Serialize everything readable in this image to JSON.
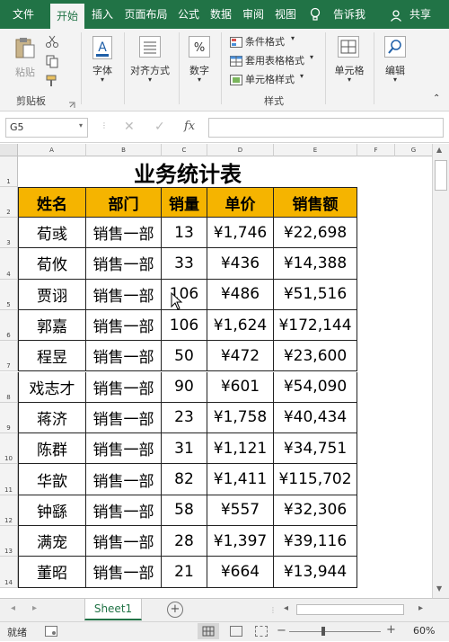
{
  "menu": {
    "tabs": [
      "文件",
      "开始",
      "插入",
      "页面布局",
      "公式",
      "数据",
      "审阅",
      "视图",
      "告诉我",
      "共享"
    ],
    "active_tab": "开始"
  },
  "ribbon": {
    "paste_label": "粘贴",
    "clipboard_label": "剪贴板",
    "font_label": "字体",
    "align_label": "对齐方式",
    "number_label": "数字",
    "cond_format": "条件格式",
    "table_format": "套用表格格式",
    "cell_style": "单元格样式",
    "style_group": "样式",
    "cells_label": "单元格",
    "edit_label": "编辑"
  },
  "formula_bar": {
    "name_box": "G5",
    "fx": "fx",
    "value": ""
  },
  "columns": [
    "A",
    "B",
    "C",
    "D",
    "E",
    "F",
    "G"
  ],
  "rows": [
    "1",
    "2",
    "3",
    "4",
    "5",
    "6",
    "7",
    "8",
    "9",
    "10",
    "11",
    "12",
    "13",
    "14"
  ],
  "sheet": {
    "title": "业务统计表",
    "headers": [
      "姓名",
      "部门",
      "销量",
      "单价",
      "销售额"
    ],
    "data": [
      [
        "荀彧",
        "销售一部",
        "13",
        "¥1,746",
        "¥22,698"
      ],
      [
        "荀攸",
        "销售一部",
        "33",
        "¥436",
        "¥14,388"
      ],
      [
        "贾诩",
        "销售一部",
        "106",
        "¥486",
        "¥51,516"
      ],
      [
        "郭嘉",
        "销售一部",
        "106",
        "¥1,624",
        "¥172,144"
      ],
      [
        "程昱",
        "销售一部",
        "50",
        "¥472",
        "¥23,600"
      ],
      [
        "戏志才",
        "销售一部",
        "90",
        "¥601",
        "¥54,090"
      ],
      [
        "蒋济",
        "销售一部",
        "23",
        "¥1,758",
        "¥40,434"
      ],
      [
        "陈群",
        "销售一部",
        "31",
        "¥1,121",
        "¥34,751"
      ],
      [
        "华歆",
        "销售一部",
        "82",
        "¥1,411",
        "¥115,702"
      ],
      [
        "钟繇",
        "销售一部",
        "58",
        "¥557",
        "¥32,306"
      ],
      [
        "满宠",
        "销售一部",
        "28",
        "¥1,397",
        "¥39,116"
      ],
      [
        "董昭",
        "销售一部",
        "21",
        "¥664",
        "¥13,944"
      ]
    ]
  },
  "sheet_tabs": [
    "Sheet1"
  ],
  "status": {
    "ready": "就绪",
    "zoom": "60%"
  },
  "colors": {
    "brand": "#217346",
    "header_fill": "#f5b400"
  }
}
